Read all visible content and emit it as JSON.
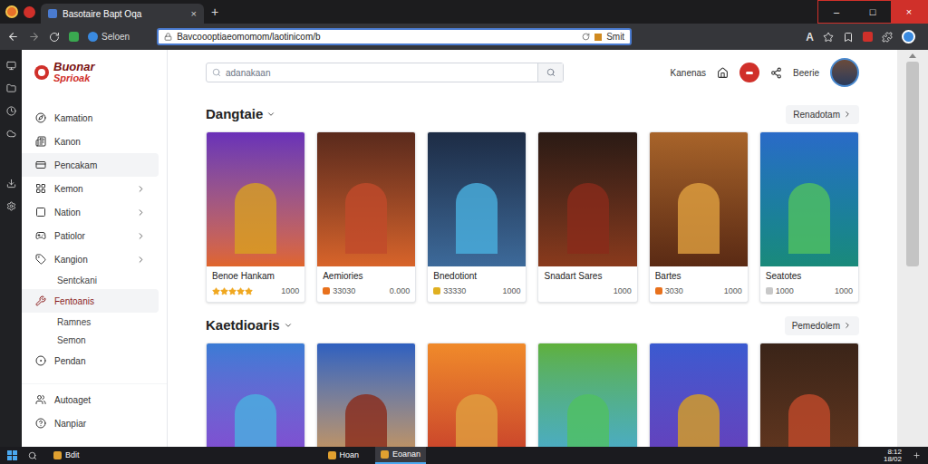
{
  "browser": {
    "tab_title": "Basotaire Bapt Oqa",
    "tab_close": "×",
    "new_tab": "+",
    "window_controls": [
      "–",
      "□",
      "×"
    ],
    "profile_label": "Seloen",
    "address": "Bavcoooptiaeomomom/laotinicom/b",
    "address_action": "Smit",
    "reader_letter": "A"
  },
  "site": {
    "logo_top": "Buonar",
    "logo_bottom": "Sprioak",
    "search_placeholder": "adanakaan",
    "header_link": "Kanenas",
    "user_name": "Beerie"
  },
  "sidebar": {
    "groups": [
      {
        "items": [
          {
            "label": "Kamation",
            "kind": "item",
            "selected": false,
            "expandable": false
          },
          {
            "label": "Kanon",
            "kind": "item",
            "selected": false,
            "expandable": false
          },
          {
            "label": "Pencakam",
            "kind": "item",
            "selected": true,
            "expandable": false
          },
          {
            "label": "Kemon",
            "kind": "item",
            "selected": false,
            "expandable": true
          },
          {
            "label": "Nation",
            "kind": "item",
            "selected": false,
            "expandable": true
          },
          {
            "label": "Patiolor",
            "kind": "item",
            "selected": false,
            "expandable": true
          },
          {
            "label": "Kangion",
            "kind": "item",
            "selected": false,
            "expandable": true
          },
          {
            "label": "Sentckani",
            "kind": "sub",
            "selected": false,
            "expandable": false
          },
          {
            "label": "Fentoanis",
            "kind": "item",
            "selected": true,
            "expandable": false
          },
          {
            "label": "Ramnes",
            "kind": "sub",
            "selected": false,
            "expandable": false
          },
          {
            "label": "Semon",
            "kind": "sub",
            "selected": false,
            "expandable": false
          },
          {
            "label": "Pendan",
            "kind": "item",
            "selected": false,
            "expandable": false
          }
        ]
      },
      {
        "items": [
          {
            "label": "Autoaget",
            "kind": "item",
            "selected": false,
            "expandable": false
          },
          {
            "label": "Nanpiar",
            "kind": "item",
            "selected": false,
            "expandable": false
          }
        ]
      }
    ]
  },
  "sections": [
    {
      "title": "Dangtaie",
      "button": "Renadotam",
      "cards": [
        {
          "kind": "rated",
          "title": "Benoe Hankam",
          "stars": 5,
          "price": "1000"
        },
        {
          "kind": "counted",
          "title": "Aemiories",
          "count": "33030",
          "color": "#e8711c",
          "price": "0.000"
        },
        {
          "kind": "counted",
          "title": "Bnedotiont",
          "count": "33330",
          "color": "#e0b020",
          "price": "1000"
        },
        {
          "kind": "plain",
          "title": "Snadart Sares",
          "price": "1000"
        },
        {
          "kind": "counted",
          "title": "Bartes",
          "count": "3030",
          "color": "#e8711c",
          "price": "1000"
        },
        {
          "kind": "counted",
          "title": "Seatotes",
          "count": "1000",
          "color": "#c8c8c8",
          "price": "1000"
        }
      ]
    },
    {
      "title": "Kaetdioaris",
      "button": "Pemedolem",
      "cards": [
        {
          "kind": "cut"
        },
        {
          "kind": "cut"
        },
        {
          "kind": "cut"
        },
        {
          "kind": "cut"
        },
        {
          "kind": "cut"
        },
        {
          "kind": "cut"
        }
      ]
    }
  ],
  "taskbar": {
    "apps": [
      {
        "label": "Bdit",
        "selected": false
      },
      {
        "label": "Hoan",
        "selected": false
      },
      {
        "label": "Eoanan",
        "selected": true
      }
    ],
    "clock_time": "8:12",
    "clock_date": "18/02"
  }
}
